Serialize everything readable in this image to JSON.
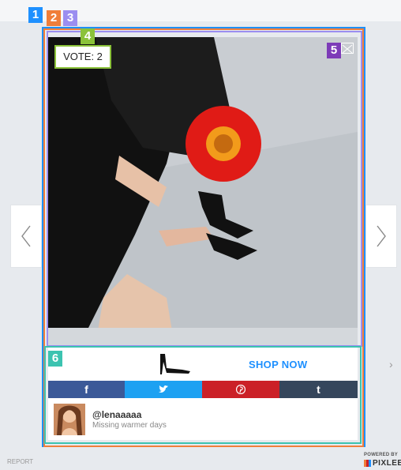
{
  "badges": [
    "1",
    "2",
    "3",
    "4",
    "5",
    "6"
  ],
  "vote": {
    "label": "VOTE: 2"
  },
  "shop": {
    "label": "SHOP NOW",
    "chevron": "›"
  },
  "social": {
    "facebook": "f",
    "twitter": "🐦",
    "pinterest": "℗",
    "tumblr": "t"
  },
  "user": {
    "handle": "@lenaaaaa",
    "caption": "Missing warmer days"
  },
  "footer": {
    "report": "REPORT",
    "powered_by": "POWERED BY",
    "brand": "PIXLEE"
  },
  "colors": {
    "facebook": "#3b5998",
    "twitter": "#1da1f2",
    "pinterest": "#cb2027",
    "tumblr": "#35465c",
    "shop_now": "#1e90ff"
  },
  "icons": {
    "nav_left": "chevron-left-icon",
    "nav_right": "chevron-right-icon",
    "close": "close-icon",
    "shoe": "high-heel-shoe-icon",
    "twitter": "twitter-bird-icon",
    "pinterest": "pinterest-icon"
  }
}
